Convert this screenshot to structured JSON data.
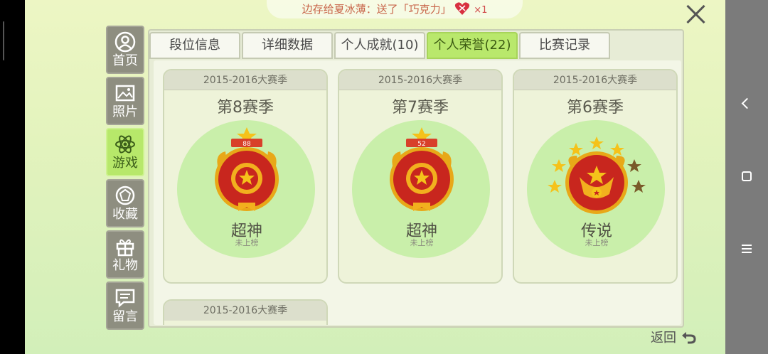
{
  "banner": {
    "text": "边存给夏冰薄：送了「巧克力」",
    "gift_count": "×1"
  },
  "sidebar": {
    "items": [
      {
        "label": "首页",
        "icon": "avatar-icon",
        "active": false
      },
      {
        "label": "照片",
        "icon": "photo-icon",
        "active": false
      },
      {
        "label": "游戏",
        "icon": "atom-icon",
        "active": true
      },
      {
        "label": "收藏",
        "icon": "gem-icon",
        "active": false
      },
      {
        "label": "礼物",
        "icon": "gift-icon",
        "active": false
      },
      {
        "label": "留言",
        "icon": "message-icon",
        "active": false
      }
    ]
  },
  "tabs": [
    {
      "label": "段位信息",
      "active": false
    },
    {
      "label": "详细数据",
      "active": false
    },
    {
      "label": "个人成就(10)",
      "active": false
    },
    {
      "label": "个人荣誉(22)",
      "active": true
    },
    {
      "label": "比赛记录",
      "active": false
    }
  ],
  "honors": [
    {
      "season_group": "2015-2016大赛季",
      "season": "第8赛季",
      "badge_number": "88",
      "rank": "超神",
      "status": "未上榜"
    },
    {
      "season_group": "2015-2016大赛季",
      "season": "第7赛季",
      "badge_number": "52",
      "rank": "超神",
      "status": "未上榜"
    },
    {
      "season_group": "2015-2016大赛季",
      "season": "第6赛季",
      "badge_stars": 7,
      "badge_stars_lit": 5,
      "rank": "传说",
      "status": "未上榜"
    },
    {
      "season_group": "2015-2016大赛季"
    }
  ],
  "footer": {
    "back_label": "返回"
  },
  "colors": {
    "active_tab": "#b9e86c",
    "badge_red": "#c8261e",
    "badge_gold": "#f2b01e"
  }
}
